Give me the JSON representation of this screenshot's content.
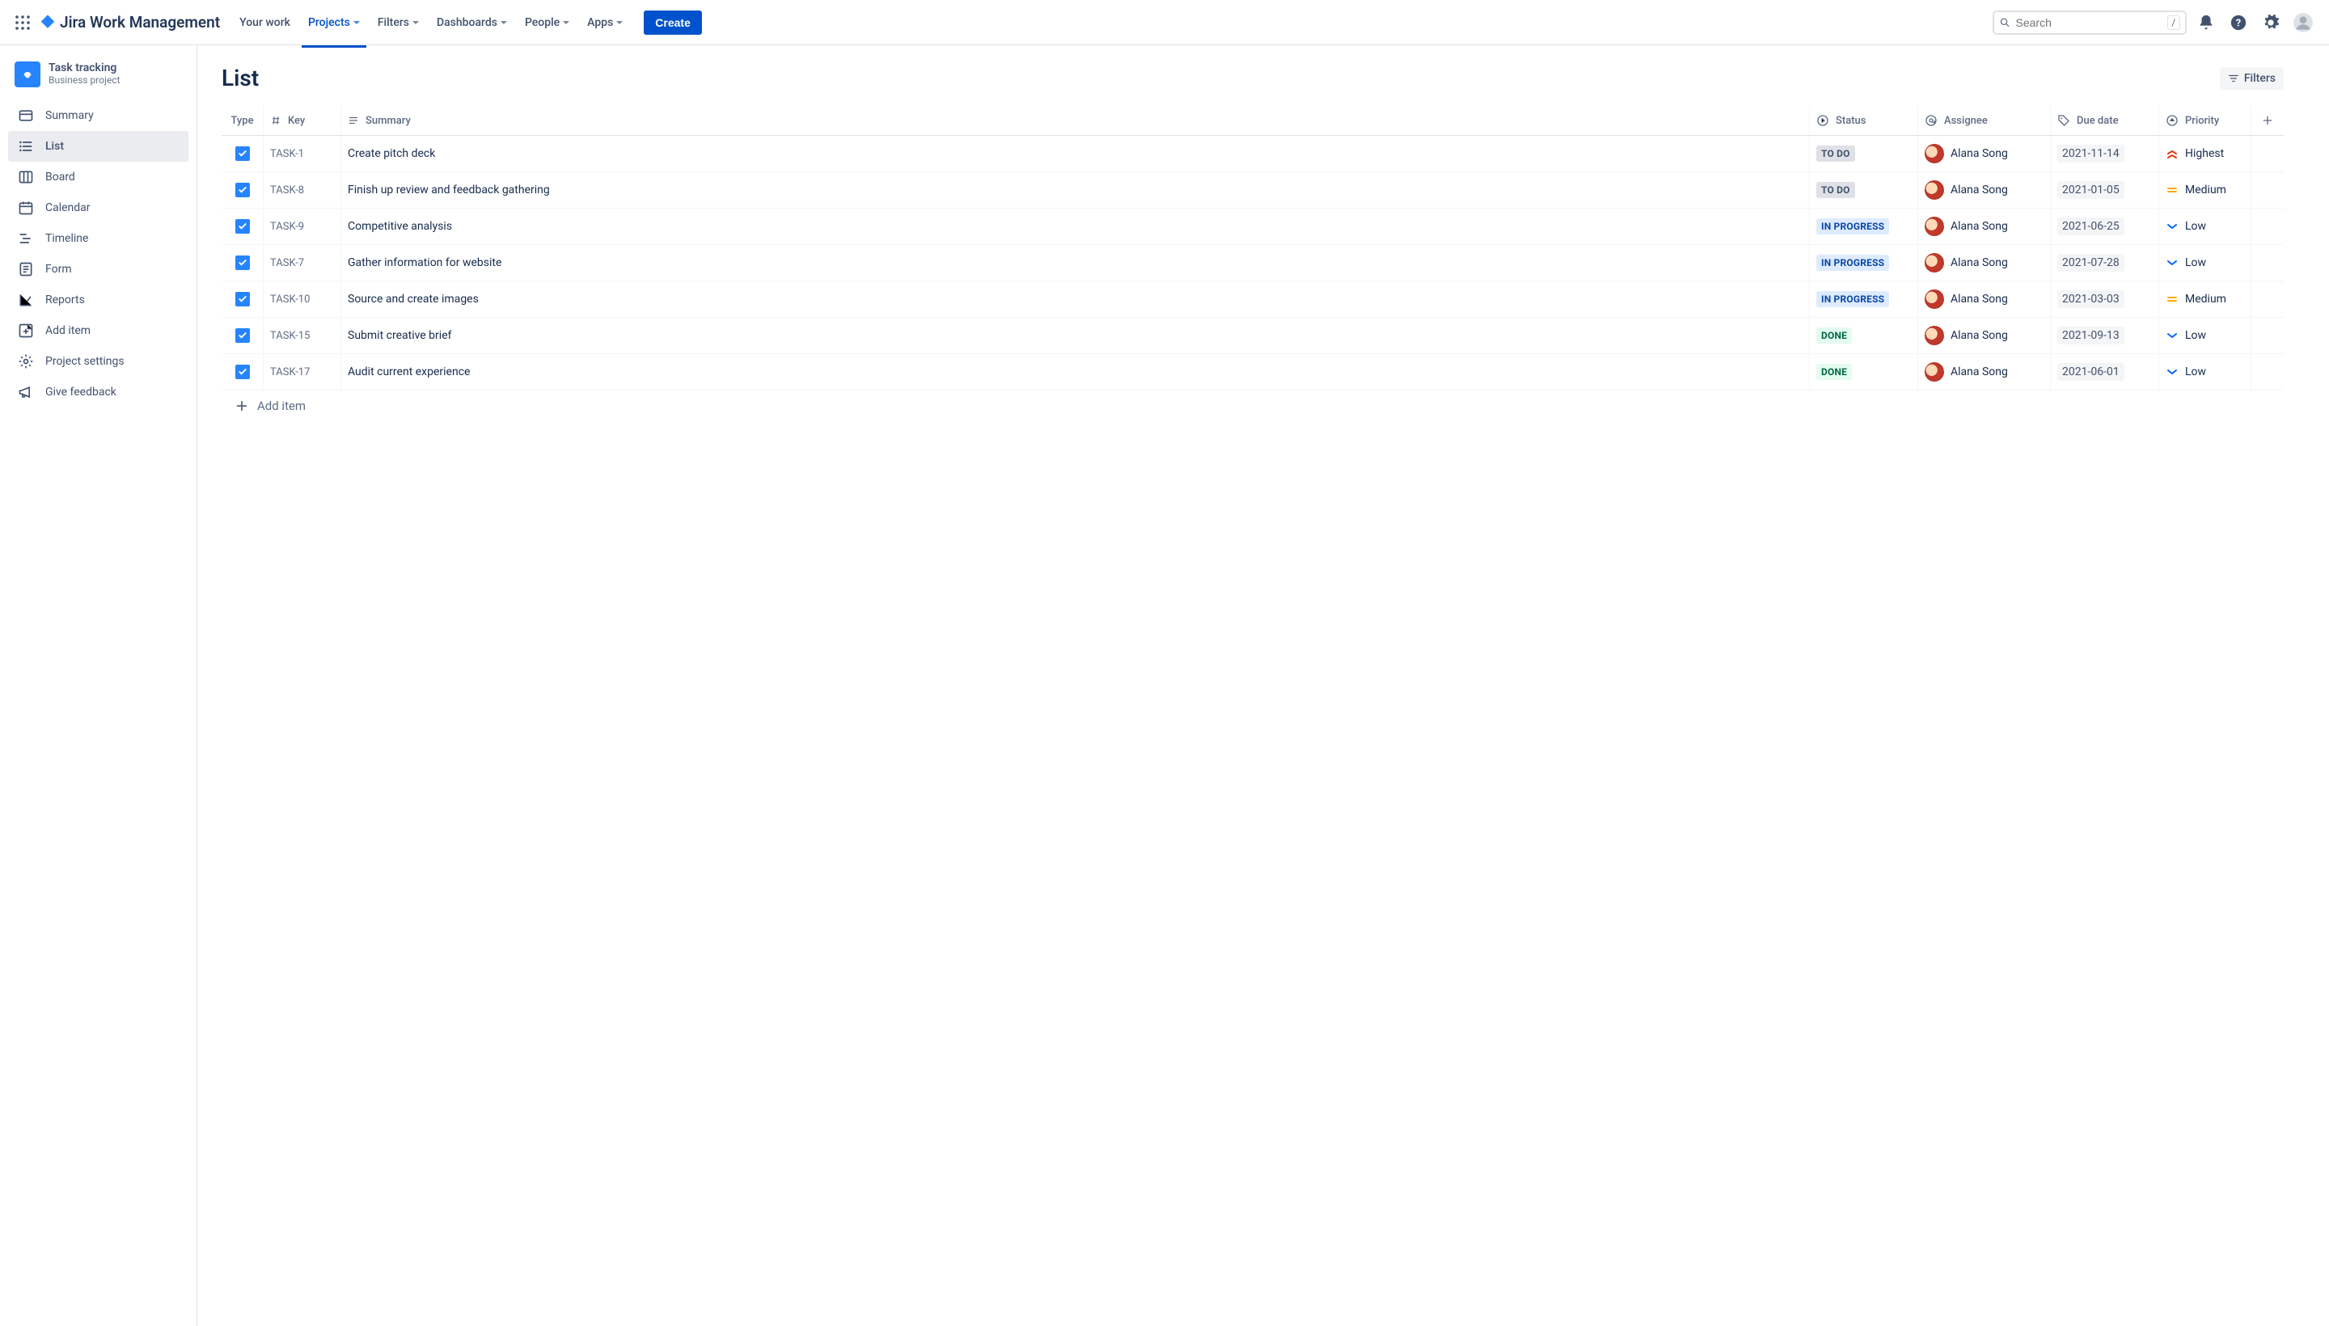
{
  "header": {
    "product_name": "Jira Work Management",
    "nav": [
      "Your work",
      "Projects",
      "Filters",
      "Dashboards",
      "People",
      "Apps"
    ],
    "active_nav_index": 1,
    "create_label": "Create",
    "search_placeholder": "Search",
    "search_shortcut": "/"
  },
  "project": {
    "name": "Task tracking",
    "type": "Business project"
  },
  "sidebar": {
    "items": [
      {
        "label": "Summary",
        "icon": "card-icon"
      },
      {
        "label": "List",
        "icon": "list-icon"
      },
      {
        "label": "Board",
        "icon": "board-icon"
      },
      {
        "label": "Calendar",
        "icon": "calendar-icon"
      },
      {
        "label": "Timeline",
        "icon": "timeline-icon"
      },
      {
        "label": "Form",
        "icon": "form-icon"
      },
      {
        "label": "Reports",
        "icon": "chart-icon"
      },
      {
        "label": "Add item",
        "icon": "add-item-icon"
      },
      {
        "label": "Project settings",
        "icon": "gear-icon"
      },
      {
        "label": "Give feedback",
        "icon": "megaphone-icon"
      }
    ],
    "active_index": 1
  },
  "page": {
    "title": "List",
    "filters_label": "Filters",
    "add_item_label": "Add item"
  },
  "columns": {
    "type": "Type",
    "key": "Key",
    "summary": "Summary",
    "status": "Status",
    "assignee": "Assignee",
    "due": "Due date",
    "priority": "Priority"
  },
  "rows": [
    {
      "key": "TASK-1",
      "summary": "Create pitch deck",
      "status": "TO DO",
      "status_class": "status-todo",
      "assignee": "Alana Song",
      "due": "2021-11-14",
      "priority": "Highest",
      "prio_icon": "highest"
    },
    {
      "key": "TASK-8",
      "summary": "Finish up review and feedback gathering",
      "status": "TO DO",
      "status_class": "status-todo",
      "assignee": "Alana Song",
      "due": "2021-01-05",
      "priority": "Medium",
      "prio_icon": "medium"
    },
    {
      "key": "TASK-9",
      "summary": "Competitive analysis",
      "status": "IN PROGRESS",
      "status_class": "status-inprogress",
      "assignee": "Alana Song",
      "due": "2021-06-25",
      "priority": "Low",
      "prio_icon": "low"
    },
    {
      "key": "TASK-7",
      "summary": "Gather information for website",
      "status": "IN PROGRESS",
      "status_class": "status-inprogress",
      "assignee": "Alana Song",
      "due": "2021-07-28",
      "priority": "Low",
      "prio_icon": "low"
    },
    {
      "key": "TASK-10",
      "summary": "Source and create images",
      "status": "IN PROGRESS",
      "status_class": "status-inprogress",
      "assignee": "Alana Song",
      "due": "2021-03-03",
      "priority": "Medium",
      "prio_icon": "medium"
    },
    {
      "key": "TASK-15",
      "summary": "Submit creative brief",
      "status": "DONE",
      "status_class": "status-done",
      "assignee": "Alana Song",
      "due": "2021-09-13",
      "priority": "Low",
      "prio_icon": "low"
    },
    {
      "key": "TASK-17",
      "summary": "Audit current experience",
      "status": "DONE",
      "status_class": "status-done",
      "assignee": "Alana Song",
      "due": "2021-06-01",
      "priority": "Low",
      "prio_icon": "low"
    }
  ]
}
